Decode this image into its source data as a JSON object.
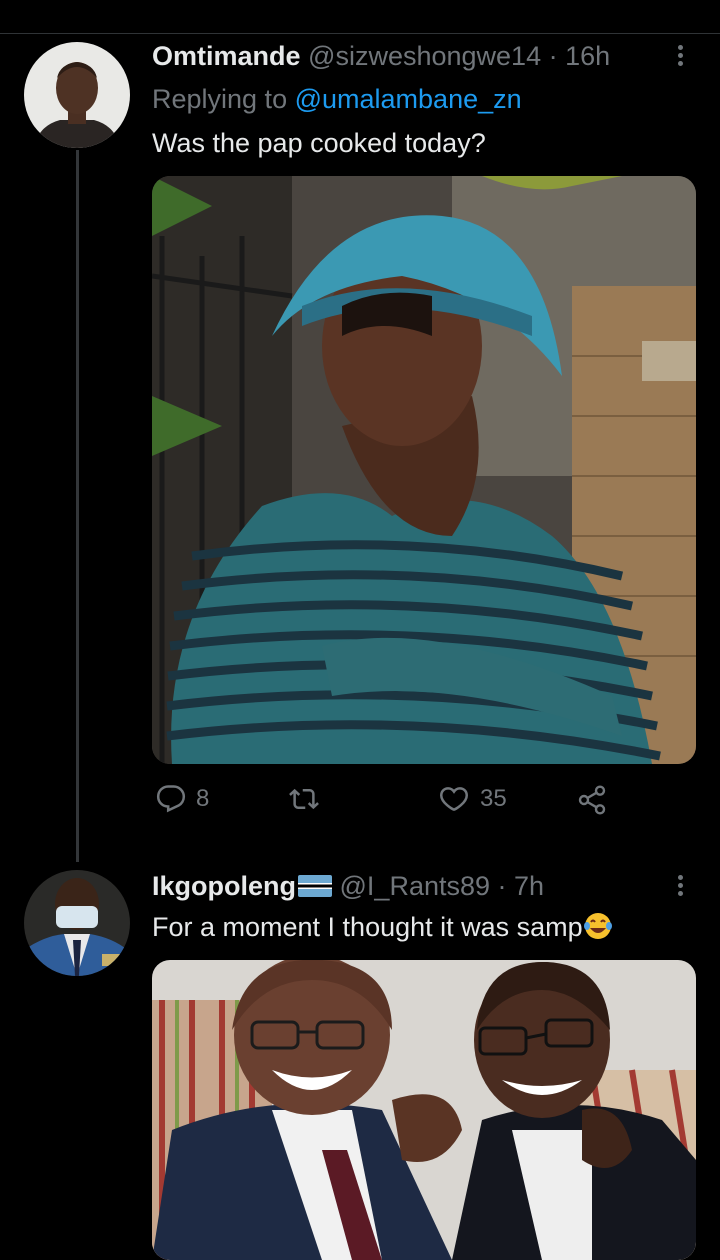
{
  "tweets": [
    {
      "display_name": "Omtimande",
      "handle": "@sizweshongwe14",
      "dot": " · ",
      "time": "16h",
      "replying_prefix": "Replying to ",
      "replying_to": "@umalambane_zn",
      "text": "Was the pap cooked today?",
      "actions": {
        "replies": "8",
        "retweets": "",
        "likes": "35"
      }
    },
    {
      "display_name": "Ikgopoleng",
      "handle": "@I_Rants89",
      "dot": " · ",
      "time": "7h",
      "text": "For a moment I thought it was samp"
    }
  ],
  "icons": {
    "reply": "reply-icon",
    "retweet": "retweet-icon",
    "like": "heart-icon",
    "share": "share-icon",
    "more": "more-vertical-icon",
    "flag": "botswana-flag-emoji",
    "laugh": "tears-of-joy-emoji"
  },
  "colors": {
    "background": "#000000",
    "text": "#e7e9ea",
    "muted": "#71767b",
    "link": "#1d9bf0",
    "divider": "#2f3336"
  }
}
